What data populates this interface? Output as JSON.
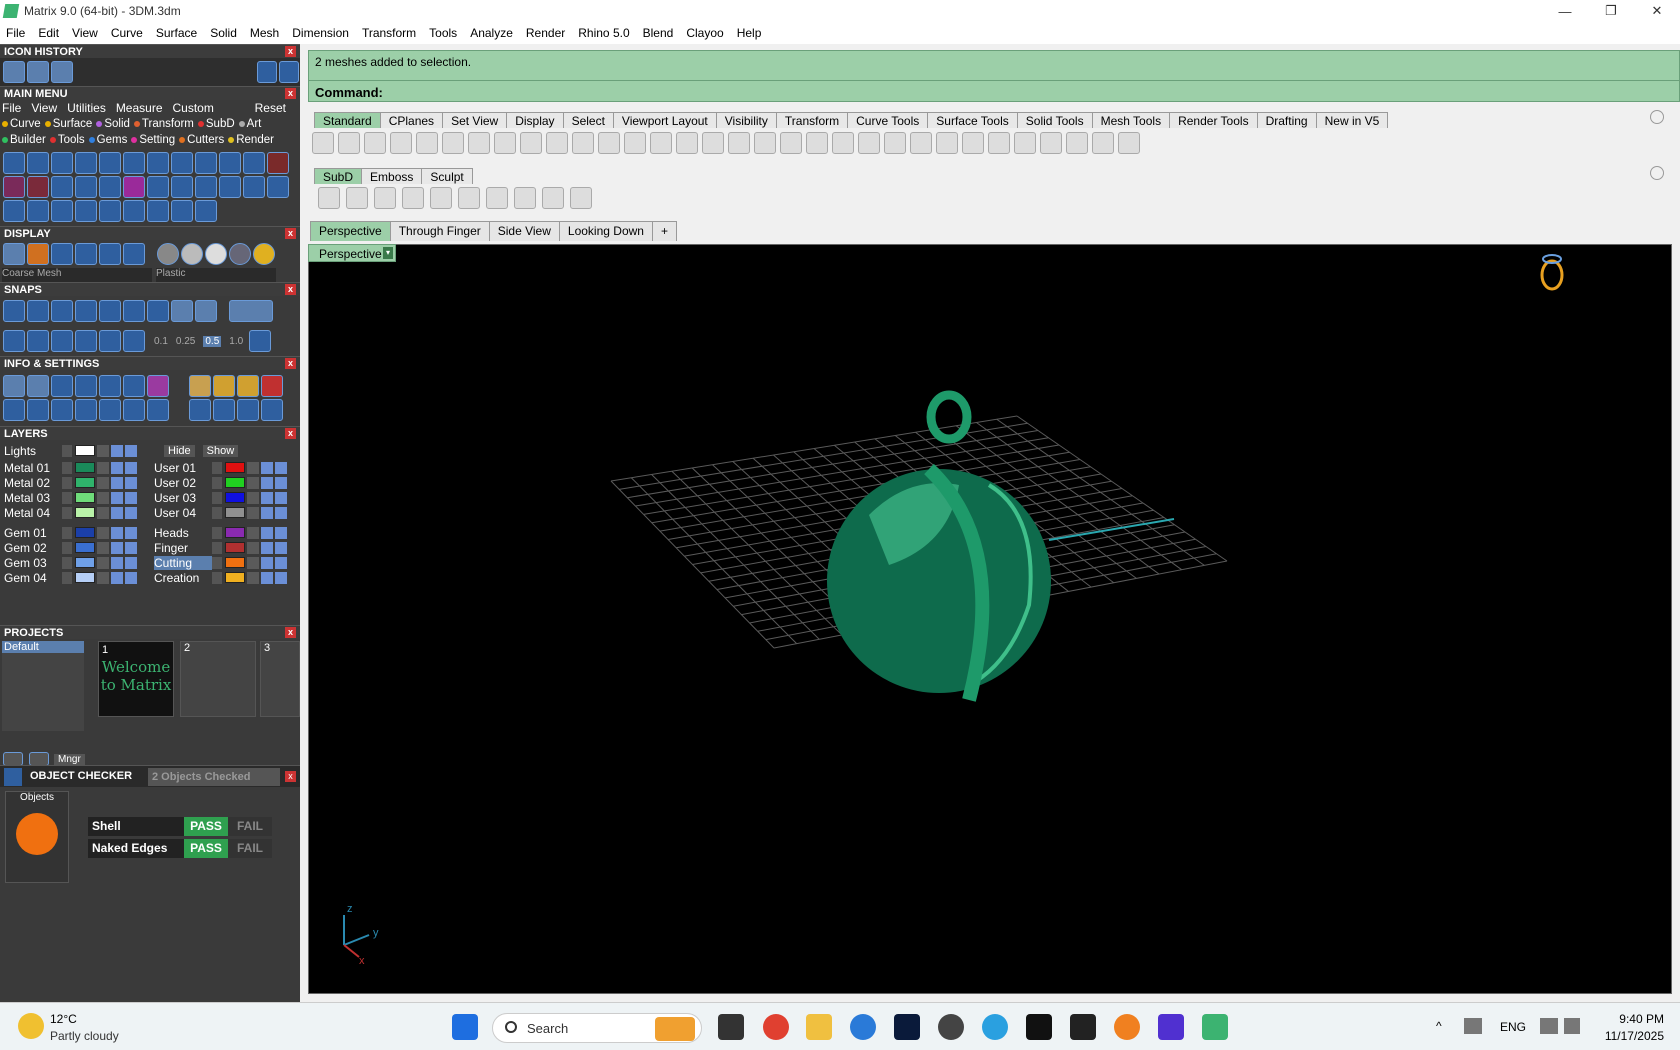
{
  "window": {
    "title": "Matrix 9.0 (64-bit) - 3DM.3dm",
    "minimize": "—",
    "maximize": "❐",
    "close": "✕"
  },
  "menubar": [
    "File",
    "Edit",
    "View",
    "Curve",
    "Surface",
    "Solid",
    "Mesh",
    "Dimension",
    "Transform",
    "Tools",
    "Analyze",
    "Render",
    "Rhino 5.0",
    "Blend",
    "Clayoo",
    "Help"
  ],
  "panels": {
    "icon_history": "ICON HISTORY",
    "main_menu": "MAIN MENU",
    "display": "DISPLAY",
    "snaps": "SNAPS",
    "info_settings": "INFO & SETTINGS",
    "layers": "LAYERS",
    "projects": "PROJECTS",
    "object_checker": "OBJECT CHECKER"
  },
  "main_menu": {
    "tabs": [
      "File",
      "View",
      "Utilities",
      "Measure",
      "Custom"
    ],
    "reset": "Reset",
    "cats1": [
      "Curve",
      "Surface",
      "Solid",
      "Transform",
      "SubD",
      "Art"
    ],
    "cats2": [
      "Builder",
      "Tools",
      "Gems",
      "Setting",
      "Cutters",
      "Render"
    ]
  },
  "display": {
    "mesh": "Coarse Mesh",
    "material": "Plastic"
  },
  "snaps": {
    "values": [
      "0.1",
      "0.25",
      "0.5",
      "1.0"
    ]
  },
  "layers": {
    "lights": "Lights",
    "hide": "Hide",
    "show": "Show",
    "left": [
      {
        "name": "Metal 01",
        "color": "#1a8a5a"
      },
      {
        "name": "Metal 02",
        "color": "#2fb36b"
      },
      {
        "name": "Metal 03",
        "color": "#6fdc7a"
      },
      {
        "name": "Metal 04",
        "color": "#b9f2a8"
      },
      {
        "name": "Gem 01",
        "color": "#1b3fa8"
      },
      {
        "name": "Gem 02",
        "color": "#3a6fd0"
      },
      {
        "name": "Gem 03",
        "color": "#6fa0e8"
      },
      {
        "name": "Gem 04",
        "color": "#b6cff6"
      }
    ],
    "right": [
      {
        "name": "User 01",
        "color": "#e01010"
      },
      {
        "name": "User 02",
        "color": "#20d020"
      },
      {
        "name": "User 03",
        "color": "#1010e0"
      },
      {
        "name": "User 04",
        "color": "#909090"
      },
      {
        "name": "Heads",
        "color": "#8a2ab0"
      },
      {
        "name": "Finger",
        "color": "#b03030"
      },
      {
        "name": "Cutting",
        "color": "#f07010"
      },
      {
        "name": "Creation",
        "color": "#f0b020"
      }
    ]
  },
  "projects": {
    "default": "Default",
    "slots": [
      "1",
      "2",
      "3"
    ],
    "welcome": "Welcome to Matrix",
    "mngr": "Mngr"
  },
  "object_checker": {
    "checked": "2  Objects Checked",
    "objects_label": "Objects",
    "checks": [
      {
        "name": "Shell",
        "pass": "PASS",
        "fail": "FAIL"
      },
      {
        "name": "Naked Edges",
        "pass": "PASS",
        "fail": "FAIL"
      }
    ]
  },
  "command": {
    "message": "2 meshes added to selection.",
    "prompt": "Command:"
  },
  "toolbar_tabs": [
    "Standard",
    "CPlanes",
    "Set View",
    "Display",
    "Select",
    "Viewport Layout",
    "Visibility",
    "Transform",
    "Curve Tools",
    "Surface Tools",
    "Solid Tools",
    "Mesh Tools",
    "Render Tools",
    "Drafting",
    "New in V5"
  ],
  "sub_tabs": [
    "SubD",
    "Emboss",
    "Sculpt"
  ],
  "view_tabs": [
    "Perspective",
    "Through Finger",
    "Side View",
    "Looking Down",
    "+"
  ],
  "viewport": {
    "label": "Perspective",
    "axis_z": "z",
    "axis_y": "y",
    "axis_x": "x"
  },
  "taskbar": {
    "weather_temp": "12°C",
    "weather_desc": "Partly cloudy",
    "search": "Search",
    "lang": "ENG",
    "time": "9:40 PM",
    "date": "11/17/2025"
  }
}
